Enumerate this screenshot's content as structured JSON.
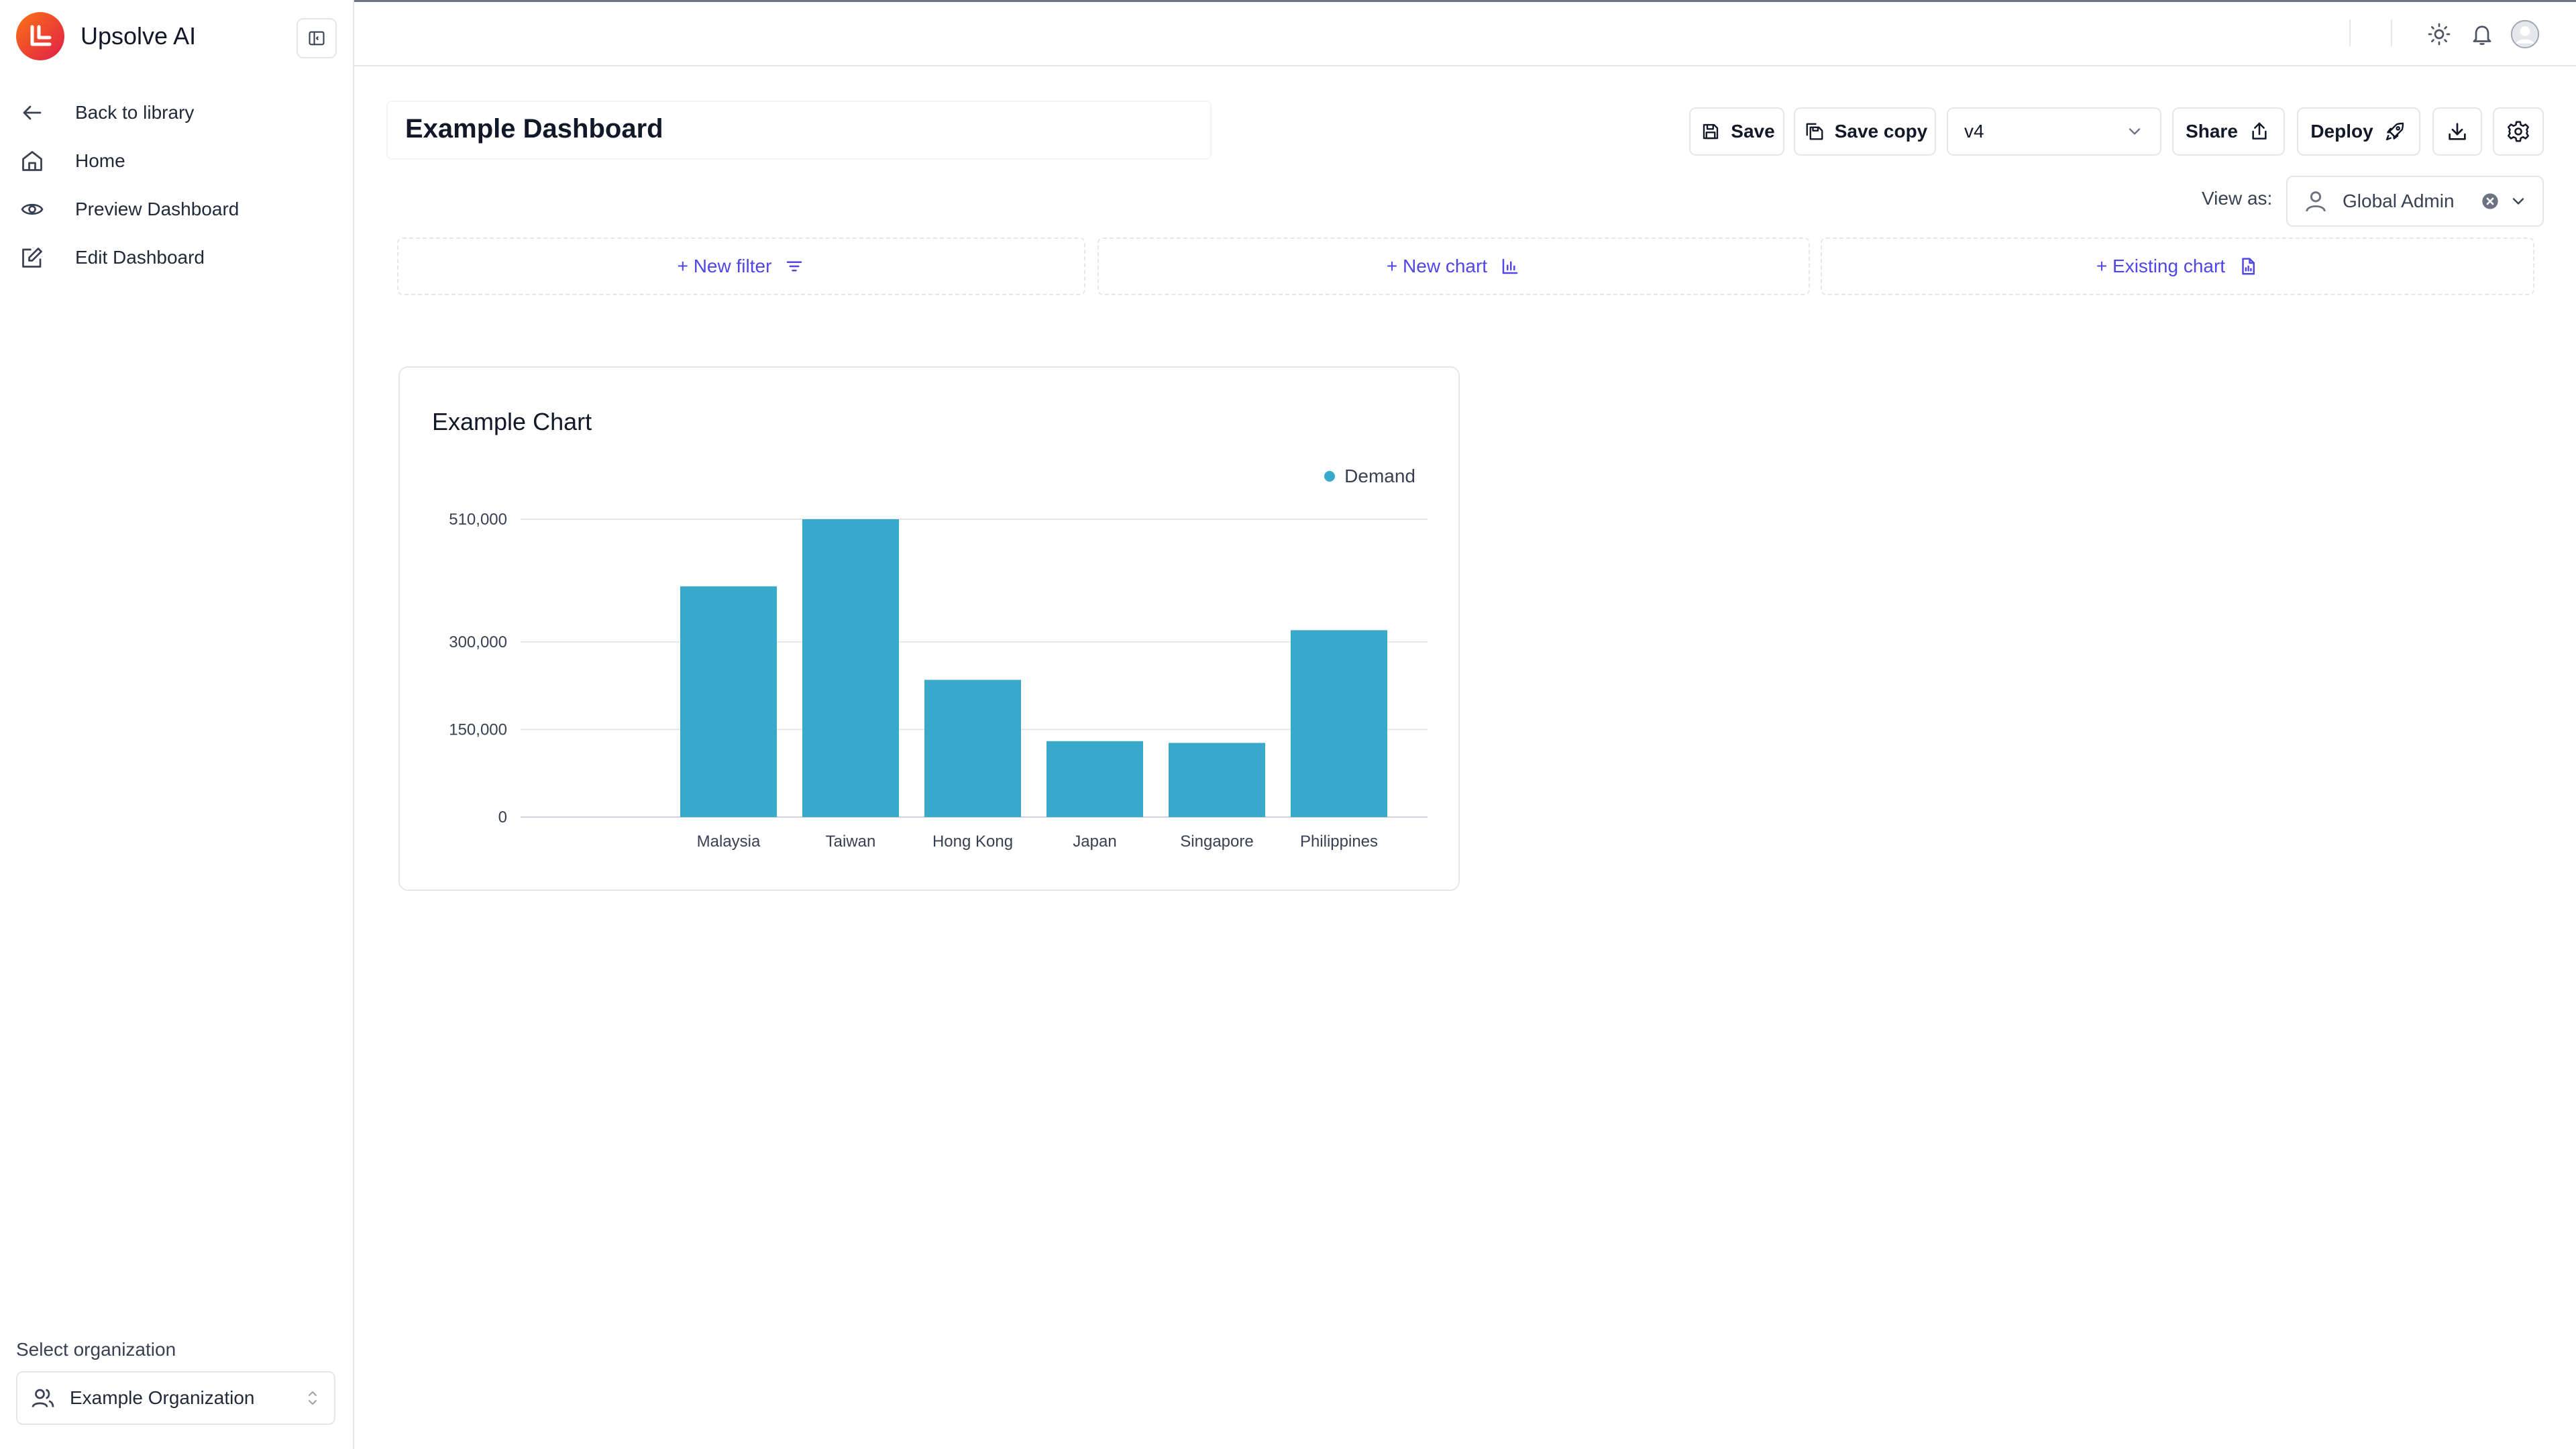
{
  "app": {
    "name": "Upsolve AI"
  },
  "sidebar": {
    "items": [
      {
        "label": "Back to library",
        "icon": "arrow-left-icon"
      },
      {
        "label": "Home",
        "icon": "home-icon"
      },
      {
        "label": "Preview Dashboard",
        "icon": "eye-icon"
      },
      {
        "label": "Edit Dashboard",
        "icon": "edit-icon"
      }
    ],
    "org_label": "Select organization",
    "org_value": "Example Organization"
  },
  "dashboard": {
    "title": "Example Dashboard",
    "toolbar": {
      "save_label": "Save",
      "save_copy_label": "Save copy",
      "version_value": "v4",
      "share_label": "Share",
      "deploy_label": "Deploy"
    },
    "view_as": {
      "label": "View as:",
      "value": "Global Admin"
    },
    "add": {
      "filter_label": "+ New filter",
      "chart_label": "+ New chart",
      "existing_label": "+ Existing chart"
    }
  },
  "colors": {
    "accent": "#4f46e5",
    "bar": "#38a9cb",
    "logo_start": "#f97316",
    "logo_end": "#e11d48"
  },
  "chart_data": {
    "type": "bar",
    "title": "Example Chart",
    "categories": [
      "Malaysia",
      "Taiwan",
      "Hong Kong",
      "Japan",
      "Singapore",
      "Philippines"
    ],
    "series": [
      {
        "name": "Demand",
        "values": [
          395000,
          510000,
          235000,
          130000,
          127000,
          320000
        ]
      }
    ],
    "yticks": [
      0,
      150000,
      300000,
      510000
    ],
    "ytick_labels": [
      "0",
      "150,000",
      "300,000",
      "510,000"
    ],
    "ylim": [
      0,
      510000
    ],
    "legend_position": "top-right",
    "grid": true
  }
}
